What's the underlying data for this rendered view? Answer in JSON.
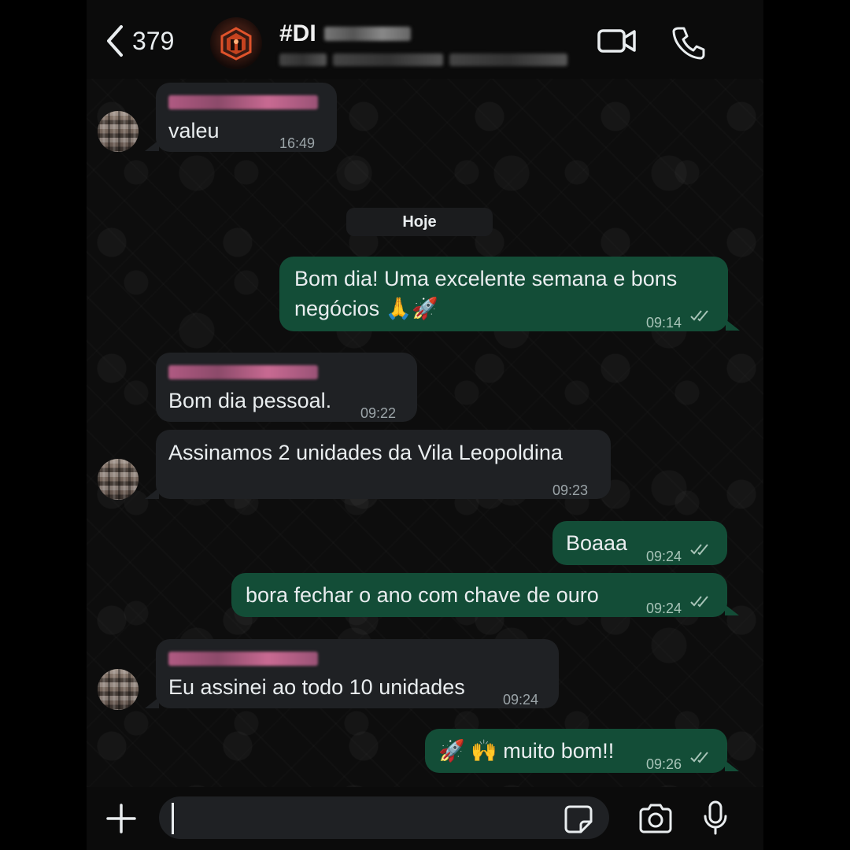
{
  "header": {
    "unread_count": "379",
    "title": "#DI",
    "icons": [
      "chevron-left-icon",
      "video-camera-icon",
      "phone-icon"
    ]
  },
  "day_chip": "Hoje",
  "messages": [
    {
      "direction": "in",
      "text": "valeu",
      "time": "16:49"
    },
    {
      "direction": "out",
      "text": "Bom dia! Uma excelente semana e bons negócios 🙏🚀",
      "time": "09:14"
    },
    {
      "direction": "in",
      "text": "Bom dia pessoal.",
      "time": "09:22"
    },
    {
      "direction": "in",
      "text": "Assinamos 2 unidades da Vila Leopoldina",
      "time": "09:23"
    },
    {
      "direction": "out",
      "text": "Boaaa",
      "time": "09:24"
    },
    {
      "direction": "out",
      "text": "bora fechar o ano com chave de ouro",
      "time": "09:24"
    },
    {
      "direction": "in",
      "text": "Eu assinei ao todo 10 unidades",
      "time": "09:24"
    },
    {
      "direction": "out",
      "text": "🚀 🙌 muito bom!!",
      "time": "09:26"
    }
  ],
  "composer": {
    "value": "",
    "icons": [
      "plus-icon",
      "sticker-icon",
      "camera-icon",
      "microphone-icon"
    ]
  },
  "colors": {
    "outgoing_bubble": "#134d37",
    "incoming_bubble": "#1f2124",
    "background": "#0b0b0b"
  }
}
